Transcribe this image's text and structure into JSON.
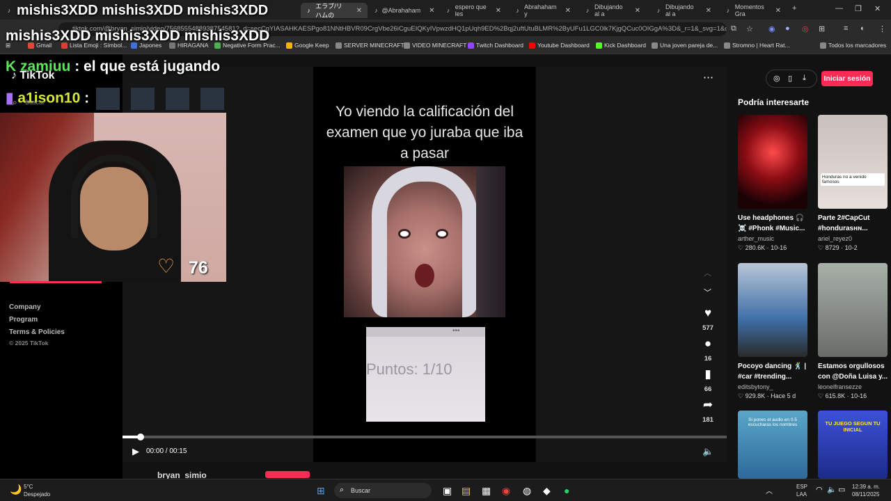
{
  "browser": {
    "tabs": [
      {
        "label": "mishis3XDD mishis3XDD mishis3XDD",
        "icon": "tiktok-icon"
      },
      {
        "label": "エラブ/リハムの",
        "icon": "tiktok-icon"
      },
      {
        "label": "@Abrahaham",
        "icon": "tiktok-icon"
      },
      {
        "label": "espero que les",
        "icon": "tiktok-icon"
      },
      {
        "label": "Abrahaham y",
        "icon": "tiktok-icon"
      },
      {
        "label": "Dibujando al a",
        "icon": "tiktok-icon"
      },
      {
        "label": "Dibujando al a",
        "icon": "tiktok-icon"
      },
      {
        "label": "Momentos Gra",
        "icon": "tiktok-icon"
      }
    ],
    "url": "tiktok.com/@bryan_simio/video/7568555488938754581?_d=secCgYIASAHKAESPgo81NNtHBVR09CrgVbe26iCguEIQKyIVpwzdHQ1pUqh9ED%2Bqj2uftUtuBLMR%2ByUFu1LGC0lk7KjgQCuc0OIGgA%3D&_r=1&_svg=1&checksu...",
    "bookmarks": [
      {
        "label": "Gmail",
        "color": "#ea4335"
      },
      {
        "label": "Lista Emoji : Símbol...",
        "color": "#e53935"
      },
      {
        "label": "Japones",
        "color": "#3f6fd8"
      },
      {
        "label": "HIRAGANA",
        "color": "#777777"
      },
      {
        "label": "Negative Form Prac...",
        "color": "#4caf50"
      },
      {
        "label": "Google Keep",
        "color": "#f4b400"
      },
      {
        "label": "SERVER MINECRAFT",
        "color": "#888888"
      },
      {
        "label": "VIDEO MINECRAFT",
        "color": "#888888"
      },
      {
        "label": "Twitch Dashboard",
        "color": "#9146ff"
      },
      {
        "label": "Youtube Dashboard",
        "color": "#ff0000"
      },
      {
        "label": "Kick Dashboard",
        "color": "#53fc18"
      },
      {
        "label": "Una joven pareja de...",
        "color": "#888888"
      },
      {
        "label": "Stromno | Heart Rat...",
        "color": "#888888"
      },
      {
        "label": "Todos los marcadores",
        "color": "#888888"
      }
    ]
  },
  "overlay": {
    "title_line2": "mishis3XDD mishis3XDD mishis3XDD",
    "chat1_user": "zamiuu",
    "chat1_text": ": el que está jugando",
    "chat2_user": "a1ison10",
    "chat2_sep": ":",
    "heart_value": "76",
    "accent": "#5ce65c"
  },
  "tiktok": {
    "logo": "TikTok",
    "search_placeholder": "Buscar",
    "footer": [
      "Company",
      "Program",
      "Terms & Policies",
      "© 2025 TikTok"
    ],
    "login_label": "Iniciar sesión",
    "video": {
      "caption": "Yo viendo la calificación del examen que yo juraba que iba a pasar",
      "score_text": "Puntos: 1/10",
      "likes": "577",
      "comments": "16",
      "saves": "66",
      "shares": "181",
      "time": "00:00 / 00:15",
      "progress": 0.03,
      "author": "bryan_simio"
    },
    "recommendations_title": "Podría interesarte",
    "recommendations": [
      {
        "title": "Use headphones 🎧 ☠️ #Phonk #Music...",
        "author": "arther_music",
        "stats": "♡ 280.6K · 10-16",
        "thumb": "#8b0d14"
      },
      {
        "title": "Parte 2#CapCut #hondurasʜɴ...",
        "author": "ariel_reyez0",
        "stats": "♡ 8729 · 10-2",
        "thumb": "#d7cfcc",
        "overlay": "Honduras no a venido famosos"
      },
      {
        "title": "Pocoyo dancing 🕺 | #car #trending...",
        "author": "editsbytony_",
        "stats": "♡ 929.8K · Hace 5 d",
        "thumb": "#3f6fa8"
      },
      {
        "title": "Estamos orgullosos con @Doña Luisa y...",
        "author": "leonelfransezze",
        "stats": "♡ 615.8K · 10-16",
        "thumb": "#8d8f8e"
      },
      {
        "title": "",
        "author": "",
        "stats": "",
        "thumb": "#5aa6c9",
        "overlay": "Si pones el audio en 0.5 escucharas los nombres"
      },
      {
        "title": "",
        "author": "",
        "stats": "",
        "thumb": "#3d52d8",
        "overlay": "TU JUEGO SEGUN TU INICIAL"
      }
    ]
  },
  "taskbar": {
    "weather_temp": "5°C",
    "weather_desc": "Despejado",
    "search": "Buscar",
    "lang": "ESP",
    "lang2": "LAA",
    "time": "12:39 a. m.",
    "date": "08/11/2025"
  }
}
